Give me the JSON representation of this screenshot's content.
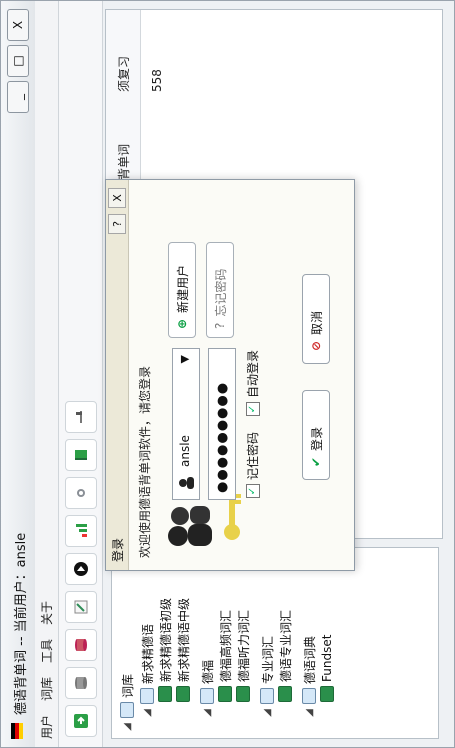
{
  "window": {
    "title": "德语背单词 -- 当前用户：ansle",
    "buttons": [
      "_",
      "□",
      "X"
    ]
  },
  "menu": [
    "用户",
    "词库",
    "工具",
    "关于"
  ],
  "tree": {
    "root": "词库",
    "items": [
      {
        "label": "新求精德语",
        "level": 1,
        "expanded": true
      },
      {
        "label": "新求精德语初级",
        "level": 2
      },
      {
        "label": "新求精德语中级",
        "level": 2
      },
      {
        "label": "德福",
        "level": 1,
        "expanded": true
      },
      {
        "label": "德福高频词汇",
        "level": 2
      },
      {
        "label": "德福听力词汇",
        "level": 2
      },
      {
        "label": "专业词汇",
        "level": 1,
        "expanded": true
      },
      {
        "label": "德语专业词汇",
        "level": 2
      },
      {
        "label": "德语词典",
        "level": 1,
        "expanded": true
      },
      {
        "label": "Fundset",
        "level": 2
      }
    ]
  },
  "table": {
    "headers": [
      "已背单词",
      "须复习"
    ],
    "values": [
      "",
      "558"
    ]
  },
  "dialog": {
    "title": "登录",
    "help": "?",
    "close": "X",
    "welcome": "欢迎使用德语背单词软件，请您登录",
    "username": "ansle",
    "password_dots": "●●●●●●●●●",
    "remember": "记住密码",
    "autologin": "自动登录",
    "login": "登录",
    "cancel": "取消",
    "new_user": "新建用户",
    "forgot": "忘记密码"
  },
  "colors": {
    "accent": "#2a8f4b",
    "warning": "#d02b2b"
  }
}
